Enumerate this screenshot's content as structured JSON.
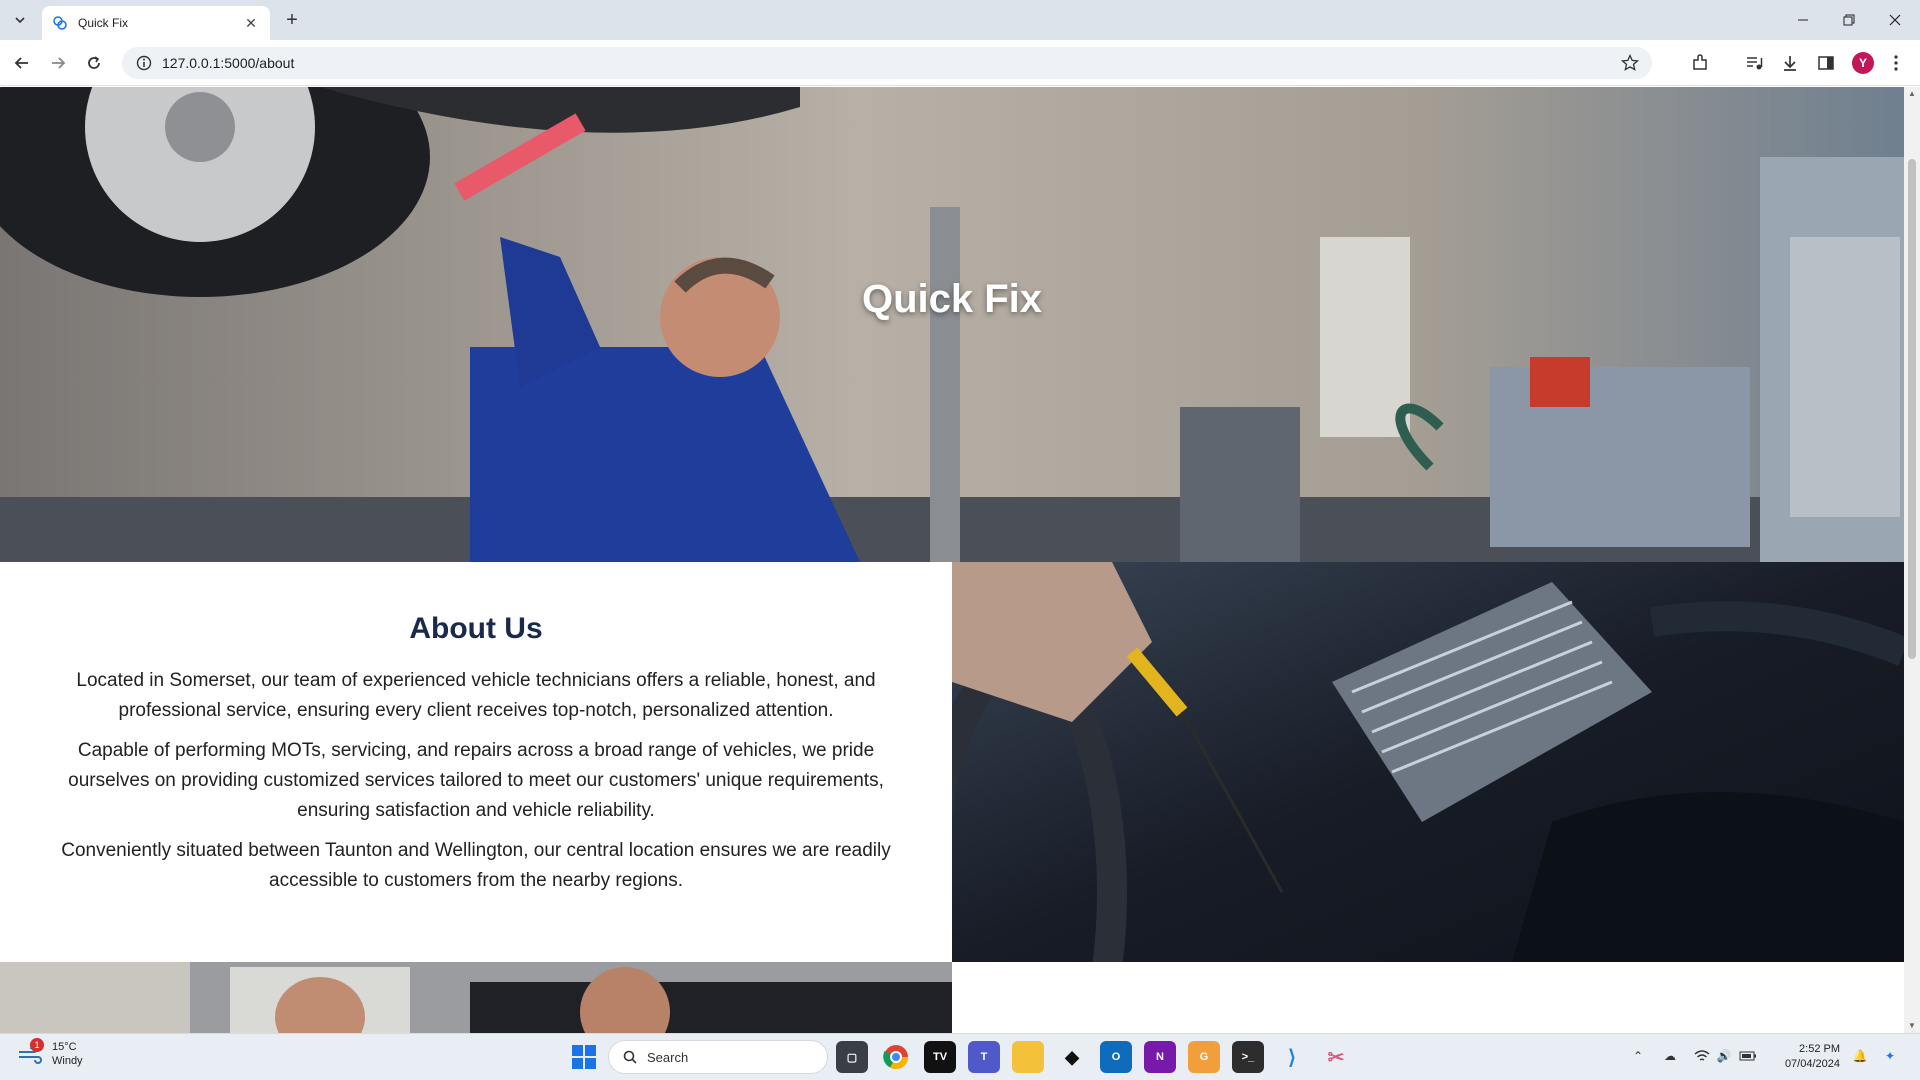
{
  "browser": {
    "tab_title": "Quick Fix",
    "url": "127.0.0.1:5000/about",
    "profile_initial": "Y",
    "favicon": "quickfix-logo-icon"
  },
  "hero": {
    "title": "Quick Fix",
    "background_image": "mechanic-under-car-photo"
  },
  "about": {
    "heading": "About Us",
    "paragraphs": [
      "Located in Somerset, our team of experienced vehicle technicians offers a reliable, honest, and professional service, ensuring every client receives top-notch, personalized attention.",
      "Capable of performing MOTs, servicing, and repairs across a broad range of vehicles, we pride ourselves on providing customized services tailored to meet our customers' unique requirements, ensuring satisfaction and vehicle reliability.",
      "Conveniently situated between Taunton and Wellington, our central location ensures we are readily accessible to customers from the nearby regions."
    ],
    "side_image": "engine-dipstick-photo",
    "bottom_image": "team-mechanics-photo"
  },
  "taskbar": {
    "weather_temp": "15°C",
    "weather_desc": "Windy",
    "weather_badge": "1",
    "search_placeholder": "Search",
    "time": "2:52 PM",
    "date": "07/04/2024",
    "apps": [
      "file-explorer-icon",
      "chrome-icon",
      "tv-app-icon",
      "teams-icon",
      "folder-icon",
      "alienware-icon",
      "outlook-icon",
      "onenote-icon",
      "preview-app-icon",
      "terminal-icon",
      "vscode-icon",
      "snipping-tool-icon"
    ]
  },
  "colors": {
    "heading": "#1a2a4a",
    "tabbar": "#dde3ea",
    "profile": "#c2185b"
  }
}
